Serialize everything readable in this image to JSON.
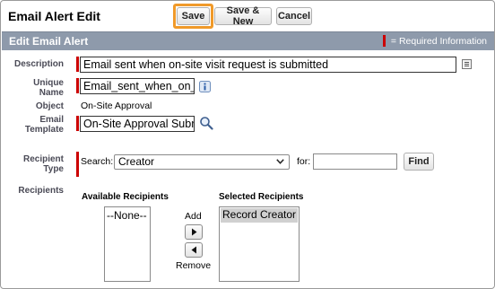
{
  "page": {
    "title": "Email Alert Edit"
  },
  "toolbar": {
    "save_label": "Save",
    "save_new_label": "Save & New",
    "cancel_label": "Cancel"
  },
  "section": {
    "title": "Edit Email Alert",
    "required_legend": "= Required Information"
  },
  "fields": {
    "description": {
      "label": "Description",
      "value": "Email sent when on-site visit request is submitted"
    },
    "unique_name": {
      "label_line1": "Unique",
      "label_line2": "Name",
      "value": "Email_sent_when_on_"
    },
    "object": {
      "label": "Object",
      "value": "On-Site Approval"
    },
    "email_template": {
      "label_line1": "Email",
      "label_line2": "Template",
      "value": "On-Site Approval Subr"
    },
    "recipient_type": {
      "label_line1": "Recipient",
      "label_line2": "Type",
      "search_label": "Search:",
      "selected": "Creator",
      "for_label": "for:",
      "for_value": "",
      "find_label": "Find"
    },
    "recipients": {
      "label": "Recipients"
    }
  },
  "available_recipients": {
    "label": "Available Recipients",
    "items": [
      "--None--"
    ]
  },
  "selected_recipients": {
    "label": "Selected Recipients",
    "items": [
      "Record Creator"
    ]
  },
  "transfer": {
    "add_label": "Add",
    "remove_label": "Remove"
  },
  "icons": {
    "info": "info-icon",
    "lookup": "magnifier-icon",
    "expand": "expand-icon",
    "arrow_right": "arrow-right-icon",
    "arrow_left": "arrow-left-icon",
    "dropdown": "chevron-down-icon"
  },
  "colors": {
    "accent_highlight": "#f09a2a",
    "required": "#cc0000",
    "section_bar": "#8e9aab"
  }
}
